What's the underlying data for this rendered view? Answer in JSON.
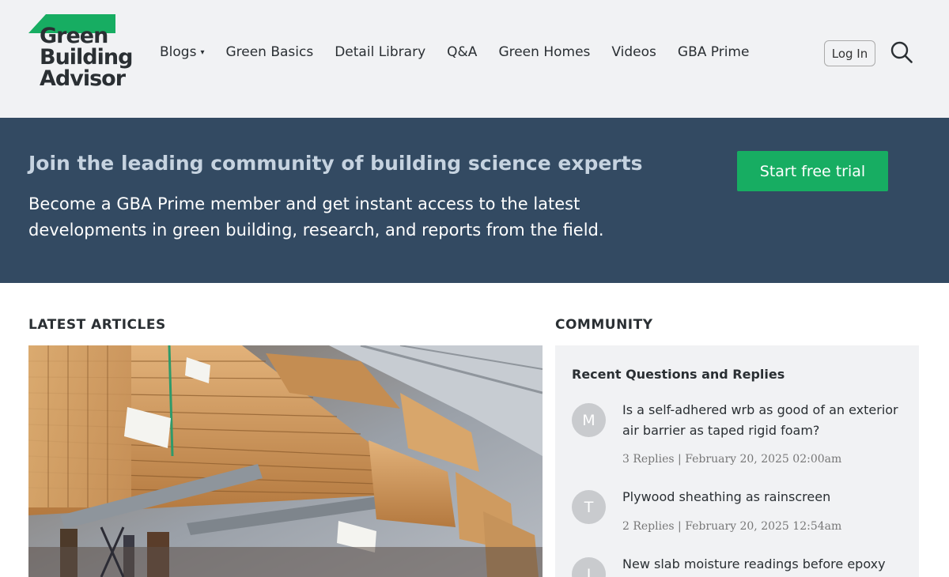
{
  "header": {
    "logo": {
      "line1": "Green",
      "line2": "Building",
      "line3": "Advisor",
      "roof_color": "#17ad62"
    },
    "nav": [
      {
        "label": "Blogs",
        "has_caret": true
      },
      {
        "label": "Green Basics"
      },
      {
        "label": "Detail Library"
      },
      {
        "label": "Q&A"
      },
      {
        "label": "Green Homes"
      },
      {
        "label": "Videos"
      },
      {
        "label": "GBA Prime"
      }
    ],
    "caret": "▾",
    "login_label": "Log In",
    "search_icon": "search-icon"
  },
  "banner": {
    "title": "Join the leading community of building science experts",
    "text": "Become a GBA Prime member and get instant access to the latest developments in green building, research, and reports from the field.",
    "cta_label": "Start free trial",
    "background": "#334a62",
    "cta_color": "#17ad62"
  },
  "latest_articles": {
    "heading": "LATEST ARTICLES"
  },
  "community": {
    "heading": "COMMUNITY",
    "panel_title": "Recent Questions and Replies",
    "questions": [
      {
        "avatar": "M",
        "title": "Is a self-adhered wrb as good of an exterior air barrier as taped rigid foam?",
        "meta": "3 Replies | February 20, 2025 02:00am"
      },
      {
        "avatar": "T",
        "title": "Plywood sheathing as rainscreen",
        "meta": "2 Replies | February 20, 2025 12:54am"
      },
      {
        "avatar": "J",
        "title": "New slab moisture readings before epoxy is",
        "meta": ""
      }
    ]
  }
}
